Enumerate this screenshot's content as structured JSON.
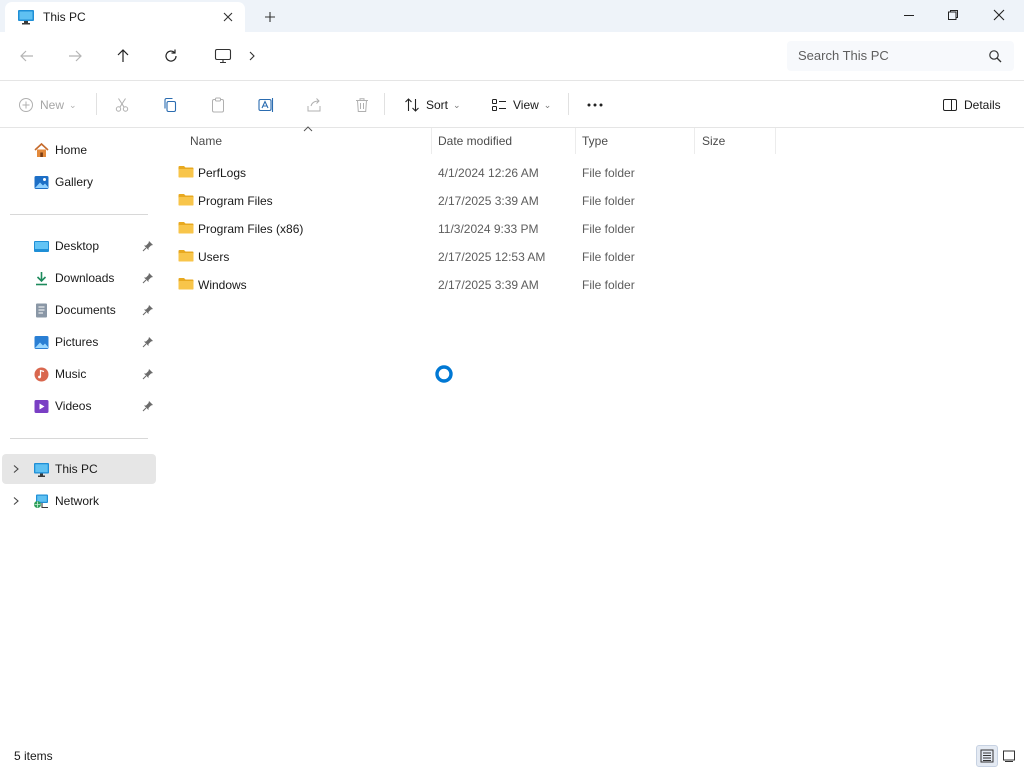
{
  "window": {
    "tab_title": "This PC",
    "colors": {
      "accent": "#0078d4",
      "folder": "#f8c54a",
      "titlebar": "#eef3f9"
    }
  },
  "search": {
    "placeholder": "Search This PC"
  },
  "commands": {
    "new_label": "New",
    "sort_label": "Sort",
    "view_label": "View",
    "details_label": "Details"
  },
  "sidebar": {
    "quick": [
      {
        "label": "Home",
        "icon": "home-icon"
      },
      {
        "label": "Gallery",
        "icon": "gallery-icon"
      }
    ],
    "pinned": [
      {
        "label": "Desktop",
        "icon": "desktop-folder-icon"
      },
      {
        "label": "Downloads",
        "icon": "download-icon"
      },
      {
        "label": "Documents",
        "icon": "documents-icon"
      },
      {
        "label": "Pictures",
        "icon": "pictures-icon"
      },
      {
        "label": "Music",
        "icon": "music-icon"
      },
      {
        "label": "Videos",
        "icon": "videos-icon"
      }
    ],
    "tree": [
      {
        "label": "This PC",
        "icon": "computer-icon",
        "selected": true
      },
      {
        "label": "Network",
        "icon": "network-icon",
        "selected": false
      }
    ]
  },
  "columns": {
    "name": "Name",
    "date": "Date modified",
    "type": "Type",
    "size": "Size"
  },
  "rows": [
    {
      "name": "PerfLogs",
      "date": "4/1/2024 12:26 AM",
      "type": "File folder"
    },
    {
      "name": "Program Files",
      "date": "2/17/2025 3:39 AM",
      "type": "File folder"
    },
    {
      "name": "Program Files (x86)",
      "date": "11/3/2024 9:33 PM",
      "type": "File folder"
    },
    {
      "name": "Users",
      "date": "2/17/2025 12:53 AM",
      "type": "File folder"
    },
    {
      "name": "Windows",
      "date": "2/17/2025 3:39 AM",
      "type": "File folder"
    }
  ],
  "status": {
    "item_count": "5 items"
  }
}
